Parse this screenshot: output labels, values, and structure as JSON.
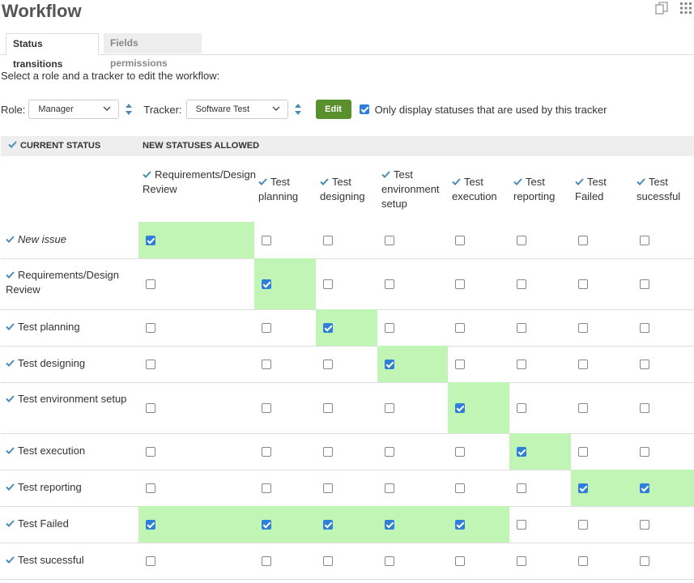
{
  "page": {
    "title": "Workflow"
  },
  "tabs": [
    {
      "label": "Status transitions",
      "active": true
    },
    {
      "label": "Fields permissions",
      "active": false
    }
  ],
  "instructions": "Select a role and a tracker to edit the workflow:",
  "filters": {
    "role_label": "Role:",
    "role_value": "Manager",
    "tracker_label": "Tracker:",
    "tracker_value": "Software Test",
    "edit_label": "Edit",
    "only_used_label": "Only display statuses that are used by this tracker",
    "only_used_checked": true
  },
  "table": {
    "current_status_header": "CURRENT STATUS",
    "new_statuses_header": "NEW STATUSES ALLOWED",
    "columns": [
      "Requirements/Design Review",
      "Test planning",
      "Test designing",
      "Test environment setup",
      "Test execution",
      "Test reporting",
      "Test Failed",
      "Test sucessful"
    ],
    "rows": [
      {
        "label": "New issue",
        "italic": true,
        "checked": [
          true,
          false,
          false,
          false,
          false,
          false,
          false,
          false
        ]
      },
      {
        "label": "Requirements/Design Review",
        "italic": false,
        "checked": [
          false,
          true,
          false,
          false,
          false,
          false,
          false,
          false
        ]
      },
      {
        "label": "Test planning",
        "italic": false,
        "checked": [
          false,
          false,
          true,
          false,
          false,
          false,
          false,
          false
        ]
      },
      {
        "label": "Test designing",
        "italic": false,
        "checked": [
          false,
          false,
          false,
          true,
          false,
          false,
          false,
          false
        ]
      },
      {
        "label": "Test environment setup",
        "italic": false,
        "checked": [
          false,
          false,
          false,
          false,
          true,
          false,
          false,
          false
        ]
      },
      {
        "label": "Test execution",
        "italic": false,
        "checked": [
          false,
          false,
          false,
          false,
          false,
          true,
          false,
          false
        ]
      },
      {
        "label": "Test reporting",
        "italic": false,
        "checked": [
          false,
          false,
          false,
          false,
          false,
          false,
          true,
          true
        ]
      },
      {
        "label": "Test Failed",
        "italic": false,
        "checked": [
          true,
          true,
          true,
          true,
          true,
          false,
          false,
          false
        ]
      },
      {
        "label": "Test sucessful",
        "italic": false,
        "checked": [
          false,
          false,
          false,
          false,
          false,
          false,
          false,
          false
        ]
      }
    ]
  },
  "colors": {
    "accent": "#2f7fd9",
    "check": "#4a8cb8",
    "highlight": "#c1f5b5",
    "edit_button": "#5a8f2d"
  },
  "icons": {
    "copy": "copy-icon",
    "apps": "apps-grid-icon",
    "check": "check-icon"
  }
}
